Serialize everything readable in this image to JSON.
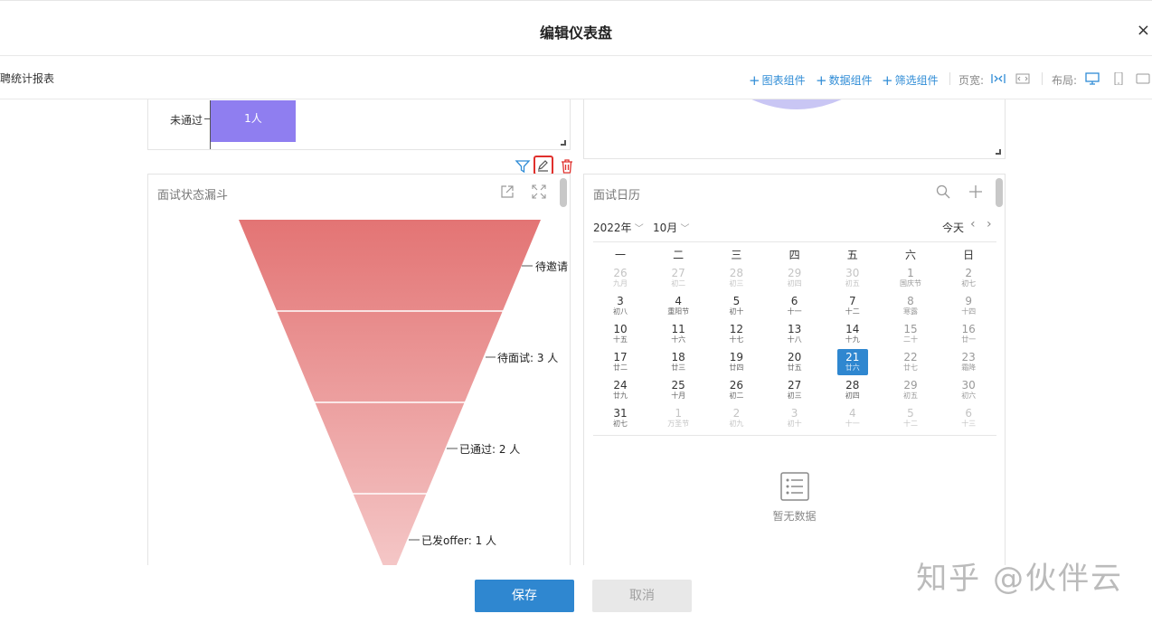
{
  "modal": {
    "title": "编辑仪表盘",
    "close": "×"
  },
  "toolbar": {
    "report_name": "招聘统计报表",
    "chart_component": "图表组件",
    "data_component": "数据组件",
    "filter_component": "筛选组件",
    "page_width_label": "页宽:",
    "layout_label": "布局:"
  },
  "top_left_card": {
    "category": "未通过",
    "bar_value": "1人"
  },
  "funnel_card": {
    "title": "面试状态漏斗",
    "labels": [
      "待邀请",
      "待面试: 3 人",
      "已通过: 2 人",
      "已发offer: 1 人"
    ]
  },
  "calendar_card": {
    "title": "面试日历",
    "year": "2022年",
    "month": "10月",
    "today_button": "今天",
    "weekdays": [
      "一",
      "二",
      "三",
      "四",
      "五",
      "六",
      "日"
    ],
    "weeks": [
      [
        [
          "26",
          "九月"
        ],
        [
          "27",
          "初二"
        ],
        [
          "28",
          "初三"
        ],
        [
          "29",
          "初四"
        ],
        [
          "30",
          "初五"
        ],
        [
          "1",
          "国庆节"
        ],
        [
          "2",
          "初七"
        ]
      ],
      [
        [
          "3",
          "初八"
        ],
        [
          "4",
          "重阳节"
        ],
        [
          "5",
          "初十"
        ],
        [
          "6",
          "十一"
        ],
        [
          "7",
          "十二"
        ],
        [
          "8",
          "寒露"
        ],
        [
          "9",
          "十四"
        ]
      ],
      [
        [
          "10",
          "十五"
        ],
        [
          "11",
          "十六"
        ],
        [
          "12",
          "十七"
        ],
        [
          "13",
          "十八"
        ],
        [
          "14",
          "十九"
        ],
        [
          "15",
          "二十"
        ],
        [
          "16",
          "廿一"
        ]
      ],
      [
        [
          "17",
          "廿二"
        ],
        [
          "18",
          "廿三"
        ],
        [
          "19",
          "廿四"
        ],
        [
          "20",
          "廿五"
        ],
        [
          "21",
          "廿六"
        ],
        [
          "22",
          "廿七"
        ],
        [
          "23",
          "霜降"
        ]
      ],
      [
        [
          "24",
          "廿九"
        ],
        [
          "25",
          "十月"
        ],
        [
          "26",
          "初二"
        ],
        [
          "27",
          "初三"
        ],
        [
          "28",
          "初四"
        ],
        [
          "29",
          "初五"
        ],
        [
          "30",
          "初六"
        ]
      ],
      [
        [
          "31",
          "初七"
        ],
        [
          "1",
          "万圣节"
        ],
        [
          "2",
          "初九"
        ],
        [
          "3",
          "初十"
        ],
        [
          "4",
          "十一"
        ],
        [
          "5",
          "十二"
        ],
        [
          "6",
          "十三"
        ]
      ]
    ],
    "empty_text": "暂无数据"
  },
  "footer": {
    "save": "保存",
    "cancel": "取消"
  },
  "watermark": "知乎 @伙伴云",
  "colors": {
    "accent": "#2f87d0",
    "purple_bar": "#8f7ef0",
    "funnel_top": "#e37474",
    "funnel_bottom": "#f5caca"
  }
}
